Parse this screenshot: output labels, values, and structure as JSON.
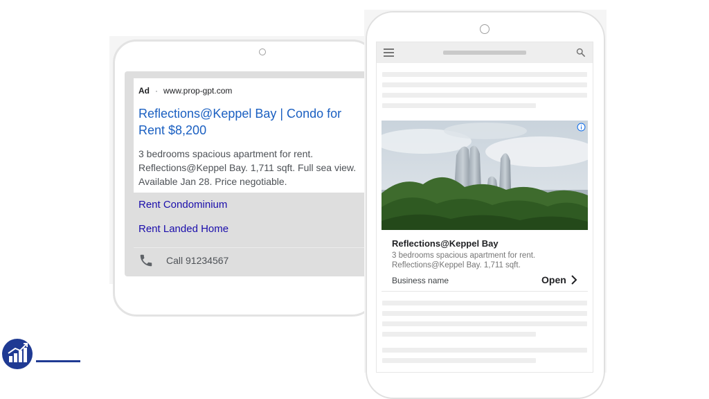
{
  "left_ad": {
    "ad_label": "Ad",
    "separator": "·",
    "url": "www.prop-gpt.com",
    "title": "Reflections@Keppel Bay | Condo for Rent $8,200",
    "description": "3 bedrooms spacious apartment for rent. Reflections@Keppel Bay. 1,711 sqft. Full sea view. Available Jan 28. Price negotiable.",
    "sitelinks": [
      "Rent Condominium",
      "Rent Landed Home"
    ],
    "call_text": "Call 91234567",
    "call_icon": "phone-icon"
  },
  "phone_ad": {
    "title": "Reflections@Keppel Bay",
    "description": "3 bedrooms spacious apartment for rent. Reflections@Keppel Bay. 1,711 sqft.",
    "business_name": "Business name",
    "cta_label": "Open",
    "cta_icon": "chevron-right-icon",
    "info_icon": "info-icon",
    "image_subject": "twin curved towers above green hills by the sea"
  },
  "phone_toolbar": {
    "menu_icon": "menu-icon",
    "search_icon": "search-icon"
  },
  "colors": {
    "link_blue": "#1a5fc1",
    "sitelink_blue": "#1a0dab",
    "logo_blue": "#1f3a93"
  }
}
